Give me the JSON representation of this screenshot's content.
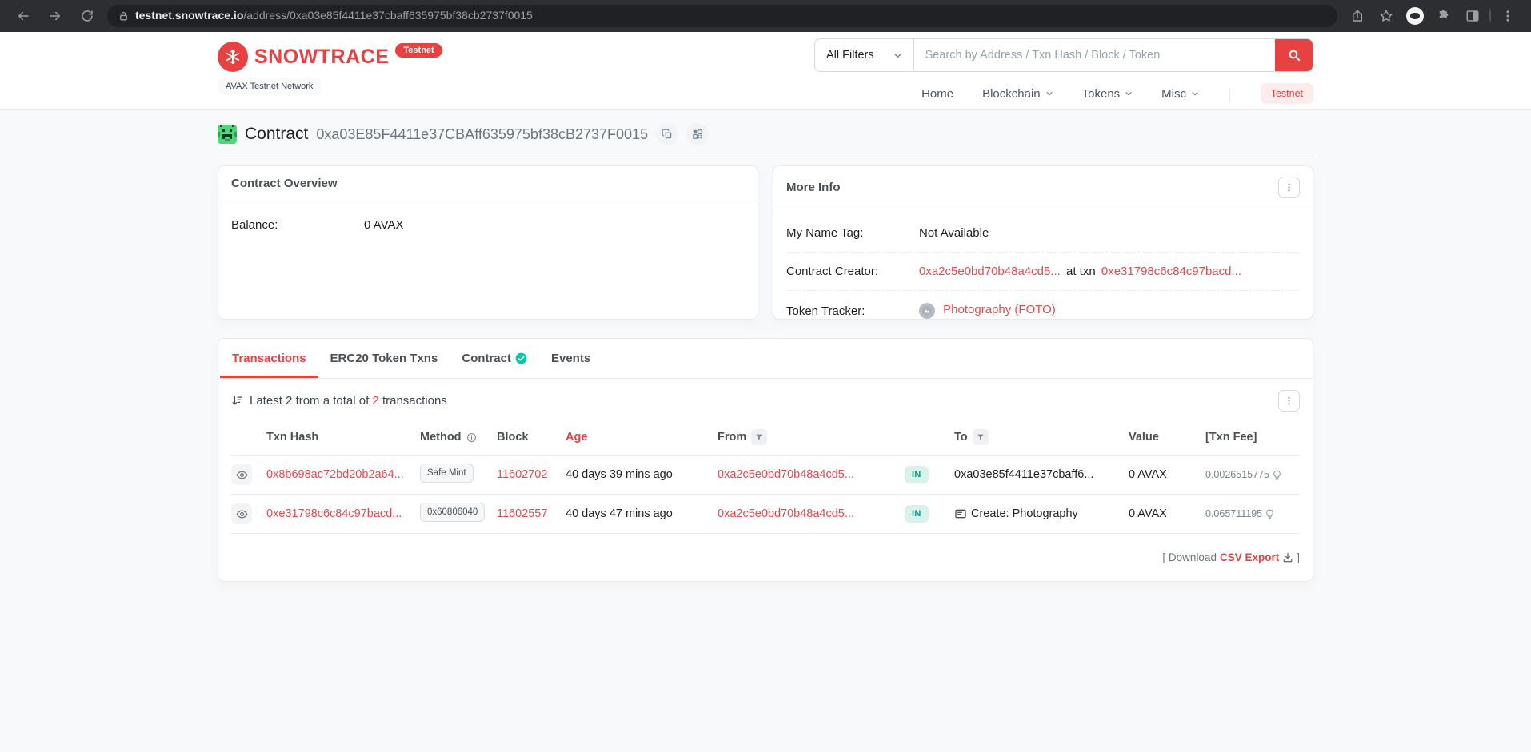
{
  "browser": {
    "url_host": "testnet.snowtrace.io",
    "url_path": "/address/0xa03e85f4411e37cbaff635975bf38cb2737f0015"
  },
  "header": {
    "brand": "SNOWTRACE",
    "brand_badge": "Testnet",
    "network_label": "AVAX Testnet Network",
    "search": {
      "filter_label": "All Filters",
      "placeholder": "Search by Address / Txn Hash / Block / Token"
    },
    "nav": {
      "home": "Home",
      "blockchain": "Blockchain",
      "tokens": "Tokens",
      "misc": "Misc",
      "testnet": "Testnet"
    }
  },
  "page_title": {
    "label": "Contract",
    "address": "0xa03E85F4411e37CBAff635975bf38cB2737F0015"
  },
  "overview": {
    "title": "Contract Overview",
    "balance_label": "Balance:",
    "balance_value": "0 AVAX"
  },
  "more_info": {
    "title": "More Info",
    "name_tag_label": "My Name Tag:",
    "name_tag_value": "Not Available",
    "creator_label": "Contract Creator:",
    "creator_address": "0xa2c5e0bd70b48a4cd5...",
    "at_txn": "at txn",
    "creator_txn": "0xe31798c6c84c97bacd...",
    "tracker_label": "Token Tracker:",
    "tracker_value": "Photography (FOTO)"
  },
  "tabs": {
    "transactions": "Transactions",
    "erc20": "ERC20 Token Txns",
    "contract": "Contract",
    "events": "Events"
  },
  "tx_panel": {
    "summary_prefix": "Latest 2 from a total of",
    "summary_count": "2",
    "summary_suffix": "transactions",
    "columns": {
      "hash": "Txn Hash",
      "method": "Method",
      "block": "Block",
      "age": "Age",
      "from": "From",
      "to": "To",
      "value": "Value",
      "fee": "[Txn Fee]"
    },
    "rows": [
      {
        "hash": "0x8b698ac72bd20b2a64...",
        "method": "Safe Mint",
        "block": "11602702",
        "age": "40 days 39 mins ago",
        "from": "0xa2c5e0bd70b48a4cd5...",
        "direction": "IN",
        "to": "0xa03e85f4411e37cbaff6...",
        "value": "0 AVAX",
        "fee": "0.0026515775"
      },
      {
        "hash": "0xe31798c6c84c97bacd...",
        "method": "0x60806040",
        "block": "11602557",
        "age": "40 days 47 mins ago",
        "from": "0xa2c5e0bd70b48a4cd5...",
        "direction": "IN",
        "to": "Create: Photography",
        "value": "0 AVAX",
        "fee": "0.065711195"
      }
    ],
    "download_prefix": "[ Download",
    "download_link": "CSV Export",
    "download_suffix": "]"
  },
  "colors": {
    "brand_red": "#e84142",
    "link_red": "#e8494d",
    "in_badge_bg": "#d9f3ec",
    "in_badge_text": "#02977e"
  }
}
